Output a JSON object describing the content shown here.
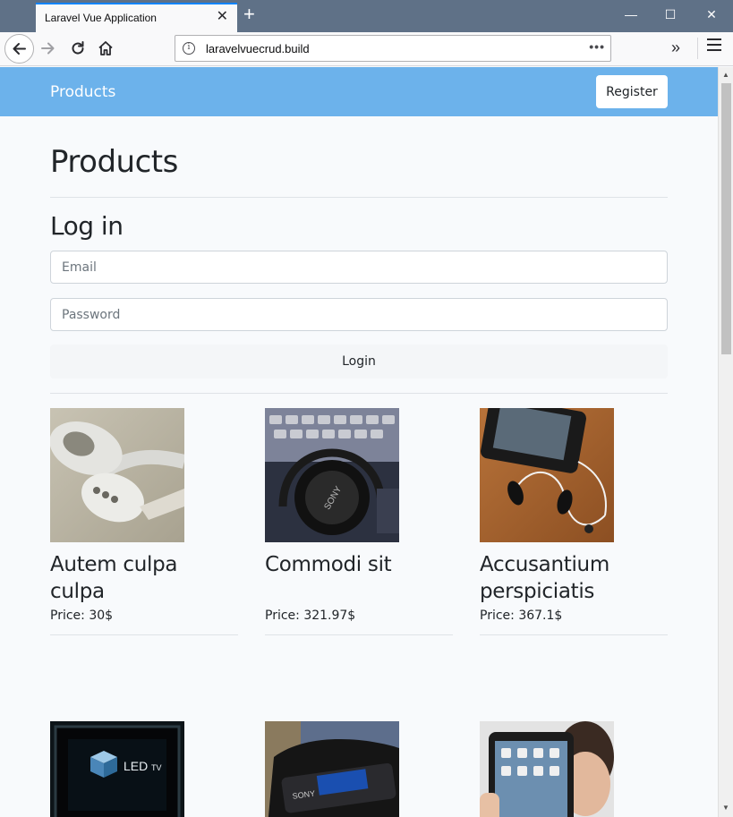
{
  "browser": {
    "tab_title": "Laravel Vue Application",
    "tab_close": "✕",
    "new_tab": "+",
    "url": "laravelvuecrud.build",
    "url_more": "•••",
    "overflow": "»",
    "minimize": "—",
    "maximize": "☐",
    "close": "✕"
  },
  "app": {
    "brand": "Products",
    "register_label": "Register",
    "nav_color": "#6cb2eb"
  },
  "page": {
    "title": "Products",
    "login_heading": "Log in",
    "email_placeholder": "Email",
    "password_placeholder": "Password",
    "login_label": "Login"
  },
  "products": [
    {
      "name": "Autem culpa culpa",
      "price": "Price: 30$",
      "image": "earphones"
    },
    {
      "name": "Commodi sit",
      "price": "Price: 321.97$",
      "image": "headphones"
    },
    {
      "name": "Accusantium perspiciatis",
      "price": "Price: 367.1$",
      "image": "phone-earbuds"
    },
    {
      "name": "",
      "price": "",
      "image": "led-tv"
    },
    {
      "name": "",
      "price": "",
      "image": "mp3-player"
    },
    {
      "name": "",
      "price": "",
      "image": "tablet"
    }
  ]
}
